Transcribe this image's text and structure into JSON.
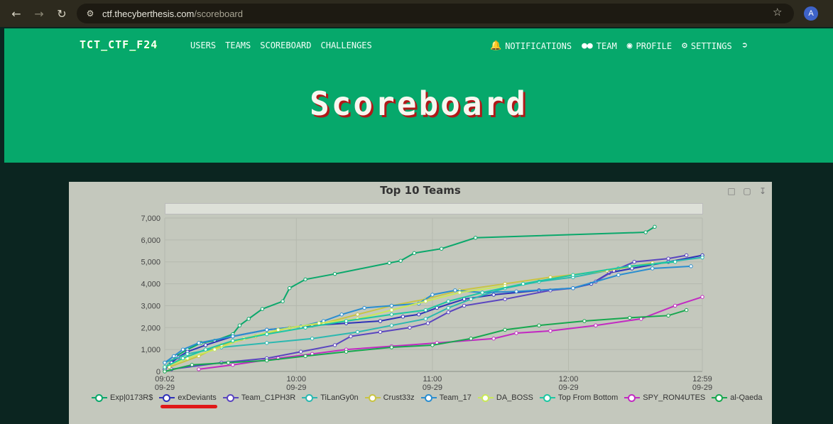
{
  "browser": {
    "url_host": "ctf.thecyberthesis.com",
    "url_path": "/scoreboard",
    "avatar_letter": "A"
  },
  "navbar": {
    "brand": "TCT_CTF_F24",
    "left_links": [
      "USERS",
      "TEAMS",
      "SCOREBOARD",
      "CHALLENGES"
    ],
    "right_links": [
      {
        "label": "NOTIFICATIONS",
        "icon": "bell-icon"
      },
      {
        "label": "TEAM",
        "icon": "users-icon"
      },
      {
        "label": "PROFILE",
        "icon": "user-circle-icon"
      },
      {
        "label": "SETTINGS",
        "icon": "cogs-icon"
      },
      {
        "label": "",
        "icon": "logout-icon"
      }
    ]
  },
  "hero": {
    "title": "Scoreboard"
  },
  "chart_data": {
    "type": "line",
    "title": "Top 10 Teams",
    "ylim": [
      0,
      7000
    ],
    "yticks": [
      "0",
      "1,000",
      "2,000",
      "3,000",
      "4,000",
      "5,000",
      "6,000",
      "7,000"
    ],
    "x_range_minutes": [
      0,
      237
    ],
    "xticks": [
      {
        "t": 0,
        "label": [
          "09:02",
          "09-29"
        ]
      },
      {
        "t": 58,
        "label": [
          "10:00",
          "09-29"
        ]
      },
      {
        "t": 118,
        "label": [
          "11:00",
          "09-29"
        ]
      },
      {
        "t": 178,
        "label": [
          "12:00",
          "09-29"
        ]
      },
      {
        "t": 237,
        "label": [
          "12:59",
          "09-29"
        ]
      }
    ],
    "grid": true,
    "legend_position": "bottom",
    "series": [
      {
        "name": "Exp|0173R$",
        "color": "#0aa86b",
        "points": [
          [
            0,
            100
          ],
          [
            2,
            300
          ],
          [
            5,
            700
          ],
          [
            10,
            1000
          ],
          [
            16,
            1300
          ],
          [
            22,
            1400
          ],
          [
            30,
            1700
          ],
          [
            33,
            2100
          ],
          [
            37,
            2400
          ],
          [
            43,
            2850
          ],
          [
            52,
            3200
          ],
          [
            55,
            3800
          ],
          [
            62,
            4200
          ],
          [
            75,
            4450
          ],
          [
            99,
            4950
          ],
          [
            104,
            5050
          ],
          [
            110,
            5400
          ],
          [
            122,
            5600
          ],
          [
            137,
            6100
          ],
          [
            212,
            6350
          ],
          [
            216,
            6600
          ]
        ]
      },
      {
        "name": "exDeviants",
        "color": "#2f32b8",
        "points": [
          [
            0,
            100
          ],
          [
            3,
            400
          ],
          [
            6,
            650
          ],
          [
            10,
            900
          ],
          [
            18,
            1200
          ],
          [
            30,
            1600
          ],
          [
            45,
            1900
          ],
          [
            65,
            2100
          ],
          [
            80,
            2200
          ],
          [
            95,
            2300
          ],
          [
            105,
            2500
          ],
          [
            112,
            2600
          ],
          [
            120,
            2900
          ],
          [
            132,
            3300
          ],
          [
            145,
            3500
          ],
          [
            165,
            3700
          ],
          [
            180,
            3800
          ],
          [
            188,
            4000
          ],
          [
            196,
            4500
          ],
          [
            206,
            4700
          ],
          [
            222,
            5000
          ],
          [
            237,
            5300
          ]
        ]
      },
      {
        "name": "Team_C1PH3R",
        "color": "#5a45c0",
        "points": [
          [
            3,
            100
          ],
          [
            25,
            400
          ],
          [
            45,
            600
          ],
          [
            60,
            900
          ],
          [
            75,
            1200
          ],
          [
            82,
            1600
          ],
          [
            95,
            1800
          ],
          [
            108,
            2000
          ],
          [
            116,
            2200
          ],
          [
            125,
            2700
          ],
          [
            132,
            3000
          ],
          [
            150,
            3300
          ],
          [
            170,
            3700
          ],
          [
            180,
            3800
          ],
          [
            190,
            4100
          ],
          [
            198,
            4600
          ],
          [
            207,
            5000
          ],
          [
            222,
            5150
          ],
          [
            230,
            5300
          ]
        ]
      },
      {
        "name": "TiLanGy0n",
        "color": "#2bb8b0",
        "points": [
          [
            0,
            400
          ],
          [
            10,
            800
          ],
          [
            25,
            1100
          ],
          [
            45,
            1300
          ],
          [
            65,
            1500
          ],
          [
            85,
            1800
          ],
          [
            100,
            2100
          ],
          [
            115,
            2400
          ],
          [
            125,
            2900
          ],
          [
            135,
            3300
          ],
          [
            150,
            3800
          ],
          [
            165,
            4100
          ],
          [
            180,
            4300
          ],
          [
            200,
            4700
          ],
          [
            215,
            4900
          ],
          [
            237,
            5200
          ]
        ]
      },
      {
        "name": "Crust33z",
        "color": "#c9c443",
        "points": [
          [
            2,
            200
          ],
          [
            15,
            700
          ],
          [
            25,
            1200
          ],
          [
            40,
            1600
          ],
          [
            55,
            2000
          ],
          [
            70,
            2200
          ],
          [
            85,
            2600
          ],
          [
            100,
            3000
          ],
          [
            115,
            3300
          ],
          [
            130,
            3700
          ],
          [
            150,
            4000
          ],
          [
            170,
            4300
          ],
          [
            195,
            4600
          ],
          [
            215,
            4950
          ]
        ]
      },
      {
        "name": "Team_17",
        "color": "#2a8ed0",
        "points": [
          [
            0,
            400
          ],
          [
            4,
            700
          ],
          [
            8,
            1000
          ],
          [
            15,
            1300
          ],
          [
            30,
            1600
          ],
          [
            45,
            1900
          ],
          [
            60,
            2050
          ],
          [
            70,
            2300
          ],
          [
            78,
            2600
          ],
          [
            88,
            2900
          ],
          [
            100,
            3000
          ],
          [
            112,
            3100
          ],
          [
            118,
            3500
          ],
          [
            128,
            3700
          ],
          [
            140,
            3600
          ],
          [
            155,
            3650
          ],
          [
            180,
            3800
          ],
          [
            200,
            4400
          ],
          [
            215,
            4700
          ],
          [
            232,
            4800
          ]
        ]
      },
      {
        "name": "DA_BOSS",
        "color": "#c9e85a",
        "points": [
          [
            0,
            200
          ],
          [
            10,
            600
          ],
          [
            22,
            1000
          ],
          [
            35,
            1500
          ],
          [
            50,
            1900
          ],
          [
            68,
            2200
          ],
          [
            85,
            2400
          ],
          [
            100,
            2800
          ],
          [
            115,
            3200
          ],
          [
            130,
            3600
          ],
          [
            150,
            3900
          ]
        ]
      },
      {
        "name": "Top From Bottom",
        "color": "#1dc7a2",
        "points": [
          [
            0,
            200
          ],
          [
            8,
            600
          ],
          [
            18,
            1000
          ],
          [
            30,
            1400
          ],
          [
            45,
            1700
          ],
          [
            62,
            2000
          ],
          [
            80,
            2300
          ],
          [
            100,
            2600
          ],
          [
            115,
            2800
          ],
          [
            125,
            3200
          ],
          [
            140,
            3600
          ],
          [
            158,
            4000
          ],
          [
            180,
            4400
          ],
          [
            205,
            4800
          ],
          [
            225,
            5000
          ]
        ]
      },
      {
        "name": "SPY_RON4UTES",
        "color": "#c22ac2",
        "points": [
          [
            15,
            100
          ],
          [
            30,
            300
          ],
          [
            50,
            600
          ],
          [
            65,
            800
          ],
          [
            80,
            1000
          ],
          [
            100,
            1150
          ],
          [
            120,
            1300
          ],
          [
            145,
            1500
          ],
          [
            155,
            1750
          ],
          [
            170,
            1850
          ],
          [
            190,
            2100
          ],
          [
            210,
            2400
          ],
          [
            225,
            3000
          ],
          [
            237,
            3400
          ]
        ]
      },
      {
        "name": "al-Qaeda",
        "color": "#17a84f",
        "points": [
          [
            0,
            0
          ],
          [
            12,
            300
          ],
          [
            28,
            400
          ],
          [
            45,
            500
          ],
          [
            62,
            700
          ],
          [
            80,
            900
          ],
          [
            100,
            1100
          ],
          [
            118,
            1200
          ],
          [
            135,
            1500
          ],
          [
            150,
            1900
          ],
          [
            165,
            2100
          ],
          [
            185,
            2300
          ],
          [
            205,
            2450
          ],
          [
            222,
            2550
          ],
          [
            230,
            2800
          ]
        ]
      }
    ]
  }
}
